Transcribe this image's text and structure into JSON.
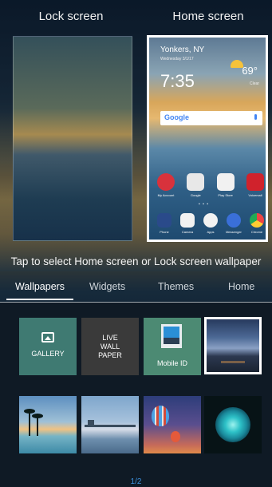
{
  "header": {
    "lock_label": "Lock screen",
    "home_label": "Home screen"
  },
  "home_preview": {
    "city": "Yonkers, NY",
    "date": "Wednesday 3/1/17",
    "time": "7:35",
    "temperature": "69°",
    "condition": "Clear",
    "search_logo": "Google",
    "apps_row1": [
      "My Account",
      "Google",
      "Play Store",
      "Voicemail"
    ],
    "apps_row2": [
      "Phone",
      "Camera",
      "Apps",
      "Messenger",
      "Chrome"
    ],
    "page_dots": "•  •  •"
  },
  "instruction": "Tap to select Home screen or Lock screen wallpaper",
  "tabs": [
    {
      "label": "Wallpapers",
      "selected": true
    },
    {
      "label": "Widgets",
      "selected": false
    },
    {
      "label": "Themes",
      "selected": false
    },
    {
      "label": "Home",
      "selected": false
    }
  ],
  "tiles": {
    "gallery": "GALLERY",
    "live_line1": "LIVE",
    "live_line2": "WALL",
    "live_line3": "PAPER",
    "mobile_id": "Mobile ID"
  },
  "page_indicator": "1/2",
  "colors": {
    "accent": "#3b8fd9",
    "selection_border": "#ffffff"
  }
}
